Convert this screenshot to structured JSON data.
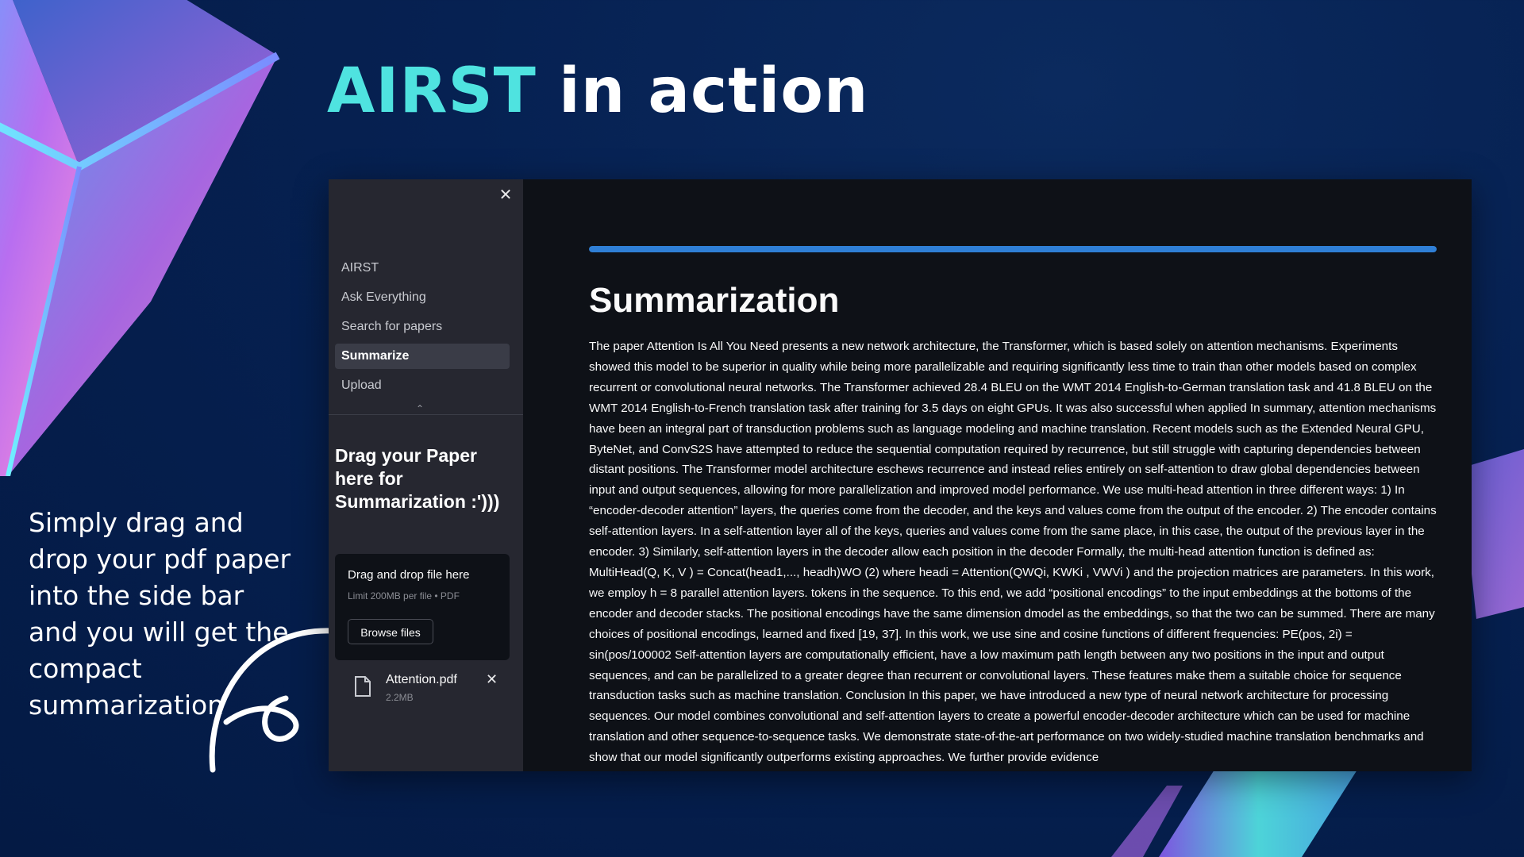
{
  "headline": {
    "accent": "AIRST",
    "rest": " in action"
  },
  "caption": "Simply drag and drop your pdf paper into the side bar and you will get the compact summarization",
  "colors": {
    "accent": "#4fe3e0",
    "background": "#041a44",
    "progress": "#2f7fd6",
    "sidebar": "#262730",
    "main": "#0e1117"
  },
  "sidebar": {
    "close_icon": "close-icon",
    "nav": [
      {
        "label": "AIRST"
      },
      {
        "label": "Ask Everything"
      },
      {
        "label": "Search for papers"
      },
      {
        "label": "Summarize",
        "active": true
      },
      {
        "label": "Upload"
      }
    ],
    "collapse_icon": "chevron-up-icon",
    "heading": "Drag your Paper here for Summarization :')))",
    "uploader": {
      "title": "Drag and drop file here",
      "limit": "Limit 200MB per file • PDF",
      "browse_label": "Browse files"
    },
    "file": {
      "icon": "file-icon",
      "name": "Attention.pdf",
      "size": "2.2MB",
      "remove_icon": "close-icon"
    }
  },
  "main": {
    "progress": 1.0,
    "title": "Summarization",
    "summary": "The paper Attention Is All You Need presents a new network architecture, the Transformer, which is based solely on attention mechanisms. Experiments showed this model to be superior in quality while being more parallelizable and requiring significantly less time to train than other models based on complex recurrent or convolutional neural networks. The Transformer achieved 28.4 BLEU on the WMT 2014 English-to-German translation task and 41.8 BLEU on the WMT 2014 English-to-French translation task after training for 3.5 days on eight GPUs. It was also successful when applied In summary, attention mechanisms have been an integral part of transduction problems such as language modeling and machine translation. Recent models such as the Extended Neural GPU, ByteNet, and ConvS2S have attempted to reduce the sequential computation required by recurrence, but still struggle with capturing dependencies between distant positions. The Transformer model architecture eschews recurrence and instead relies entirely on self-attention to draw global dependencies between input and output sequences, allowing for more parallelization and improved model performance. We use multi-head attention in three different ways: 1) In “encoder-decoder attention” layers, the queries come from the decoder, and the keys and values come from the output of the encoder. 2) The encoder contains self-attention layers. In a self-attention layer all of the keys, queries and values come from the same place, in this case, the output of the previous layer in the encoder. 3) Similarly, self-attention layers in the decoder allow each position in the decoder Formally, the multi-head attention function is defined as: MultiHead(Q, K, V ) = Concat(head1,..., headh)WO (2) where headi = Attention(QWQi, KWKi , VWVi ) and the projection matrices are parameters. In this work, we employ h = 8 parallel attention layers. tokens in the sequence. To this end, we add “positional encodings” to the input embeddings at the bottoms of the encoder and decoder stacks. The positional encodings have the same dimension dmodel as the embeddings, so that the two can be summed. There are many choices of positional encodings, learned and fixed [19, 37]. In this work, we use sine and cosine functions of different frequencies: PE(pos, 2i) = sin(pos/100002 Self-attention layers are computationally efficient, have a low maximum path length between any two positions in the input and output sequences, and can be parallelized to a greater degree than recurrent or convolutional layers. These features make them a suitable choice for sequence transduction tasks such as machine translation. Conclusion In this paper, we have introduced a new type of neural network architecture for processing sequences. Our model combines convolutional and self-attention layers to create a powerful encoder-decoder architecture which can be used for machine translation and other sequence-to-sequence tasks. We demonstrate state-of-the-art performance on two widely-studied machine translation benchmarks and show that our model significantly outperforms existing approaches. We further provide evidence"
  }
}
